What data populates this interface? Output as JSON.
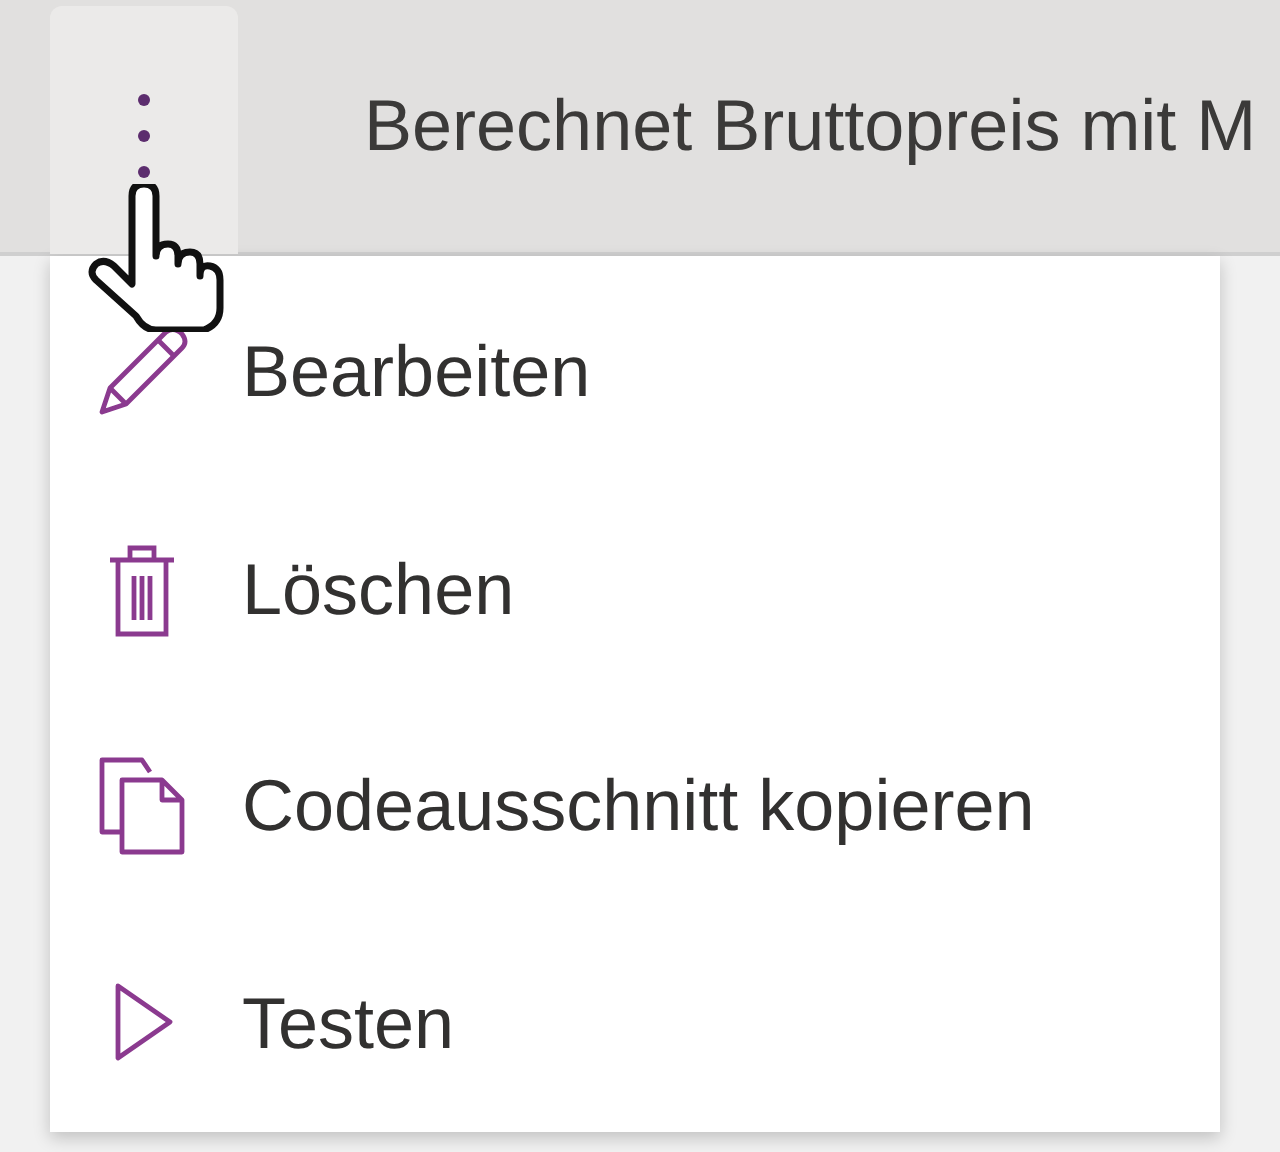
{
  "header": {
    "title": "Berechnet Bruttopreis mit M"
  },
  "menu": {
    "items": [
      {
        "kind": "pencil",
        "label": "Bearbeiten"
      },
      {
        "kind": "trash",
        "label": "Löschen"
      },
      {
        "kind": "copy",
        "label": "Codeausschnitt kopieren"
      },
      {
        "kind": "play",
        "label": "Testen"
      }
    ]
  }
}
